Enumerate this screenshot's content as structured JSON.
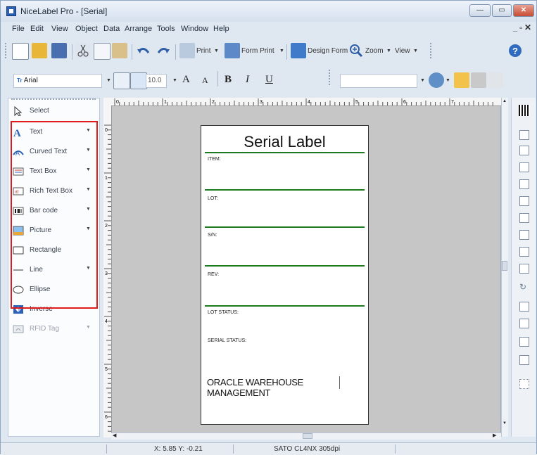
{
  "window": {
    "title": "NiceLabel Pro - [Serial]",
    "controls": {
      "minimize": "—",
      "maximize": "▭",
      "close": "✕"
    },
    "doc_controls": {
      "restore": "_ ▫",
      "close": "✕"
    }
  },
  "menu": [
    "File",
    "Edit",
    "View",
    "Object",
    "Data",
    "Arrange",
    "Tools",
    "Window",
    "Help"
  ],
  "toolbar1": {
    "print_label": "Print",
    "form_print_label": "Form Print",
    "design_form_label": "Design Form",
    "zoom_label": "Zoom",
    "view_label": "View"
  },
  "toolbar2": {
    "font_name": "Arial",
    "font_size": "10.0",
    "bold": "B",
    "italic": "I",
    "underline": "U",
    "grow": "A",
    "shrink": "A"
  },
  "left_panel": {
    "items": [
      {
        "label": "Select",
        "icon": "select-arrow-icon",
        "dropdown": false
      },
      {
        "label": "Text",
        "icon": "text-icon",
        "dropdown": true
      },
      {
        "label": "Curved Text",
        "icon": "curved-text-icon",
        "dropdown": true
      },
      {
        "label": "Text Box",
        "icon": "text-box-icon",
        "dropdown": true
      },
      {
        "label": "Rich Text Box",
        "icon": "rich-text-box-icon",
        "dropdown": true
      },
      {
        "label": "Bar code",
        "icon": "barcode-icon",
        "dropdown": true
      },
      {
        "label": "Picture",
        "icon": "picture-icon",
        "dropdown": true
      },
      {
        "label": "Rectangle",
        "icon": "rectangle-icon",
        "dropdown": false
      },
      {
        "label": "Line",
        "icon": "line-icon",
        "dropdown": true
      },
      {
        "label": "Ellipse",
        "icon": "ellipse-icon",
        "dropdown": false
      },
      {
        "label": "Inverse",
        "icon": "inverse-icon",
        "dropdown": false
      },
      {
        "label": "RFID Tag",
        "icon": "rfid-tag-icon",
        "dropdown": true
      }
    ]
  },
  "label": {
    "title": "Serial Label",
    "fields": [
      "ITEM:",
      "LOT:",
      "S/N:",
      "REV:",
      "LOT STATUS:",
      "SERIAL STATUS:"
    ],
    "footer": "ORACLE WAREHOUSE MANAGEMENT"
  },
  "ruler": {
    "marks": [
      "0",
      "1",
      "2",
      "3",
      "4",
      "5",
      "6",
      "7"
    ]
  },
  "vruler": {
    "marks": [
      "0",
      "1",
      "2",
      "3",
      "4",
      "5",
      "6"
    ]
  },
  "status": {
    "coordinates": "X: 5.85 Y: -0.21",
    "printer": "SATO CL4NX 305dpi"
  },
  "colors": {
    "highlight": "#e01b1b",
    "field_line": "#1d7a1d",
    "canvas": "#c6c6c6"
  }
}
